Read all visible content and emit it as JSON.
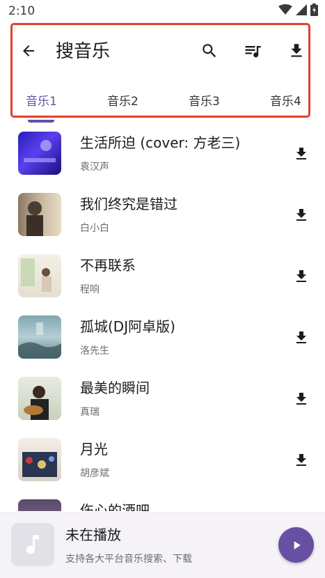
{
  "status": {
    "time": "2:10"
  },
  "header": {
    "title": "搜音乐",
    "tabs": [
      "音乐1",
      "音乐2",
      "音乐3",
      "音乐4"
    ]
  },
  "songs": [
    {
      "title": "生活所迫 (cover: 方老三)",
      "artist": "袁汉声",
      "cover": "cover-blue-piano"
    },
    {
      "title": "我们终究是错过",
      "artist": "白小白",
      "cover": "cover-man-portrait"
    },
    {
      "title": "不再联系",
      "artist": "程响",
      "cover": "cover-girl-window"
    },
    {
      "title": "孤城(DJ阿卓版)",
      "artist": "洛先生",
      "cover": "cover-foggy-landscape"
    },
    {
      "title": "最美的瞬间",
      "artist": "真瑞",
      "cover": "cover-guitar-man"
    },
    {
      "title": "月光",
      "artist": "胡彦斌",
      "cover": "cover-illustration"
    },
    {
      "title": "伤心的酒吧",
      "artist": "",
      "cover": "cover-dark"
    }
  ],
  "player": {
    "title": "未在播放",
    "subtitle": "支持各大平台音乐搜索、下载"
  },
  "colors": {
    "accent": "#6750a4",
    "highlight_border": "#e0402d"
  }
}
